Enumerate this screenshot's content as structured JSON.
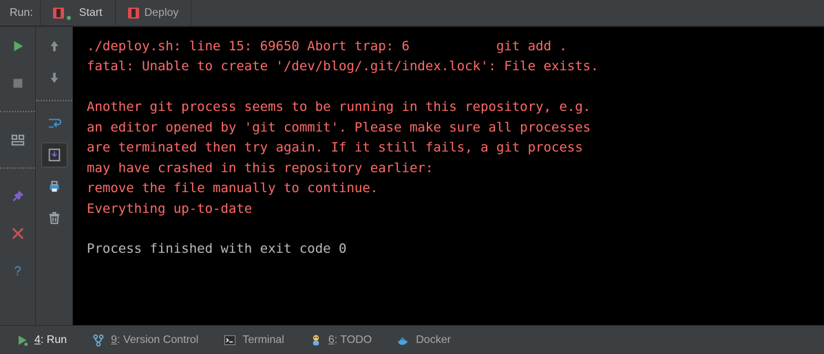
{
  "header": {
    "label": "Run:",
    "tabs": [
      {
        "label": "Start",
        "active": true
      },
      {
        "label": "Deploy",
        "active": false
      }
    ]
  },
  "gutter_a": {
    "items": [
      {
        "name": "run-play-icon",
        "kind": "play"
      },
      {
        "name": "run-stop-icon",
        "kind": "stop"
      },
      {
        "name": "break",
        "kind": "break"
      },
      {
        "name": "layout-icon",
        "kind": "layout"
      },
      {
        "name": "break",
        "kind": "break"
      },
      {
        "name": "pin-icon",
        "kind": "pin"
      },
      {
        "name": "close-panel-icon",
        "kind": "close"
      },
      {
        "name": "help-icon",
        "kind": "help"
      }
    ]
  },
  "gutter_b": {
    "items": [
      {
        "name": "scroll-up-icon",
        "kind": "arrow-up"
      },
      {
        "name": "scroll-down-icon",
        "kind": "arrow-down"
      },
      {
        "name": "break",
        "kind": "break"
      },
      {
        "name": "soft-wrap-icon",
        "kind": "wrap"
      },
      {
        "name": "scroll-to-end-icon",
        "kind": "scroll-end",
        "active": true
      },
      {
        "name": "print-icon",
        "kind": "print"
      },
      {
        "name": "clear-all-icon",
        "kind": "trash"
      }
    ]
  },
  "console": {
    "lines": [
      {
        "cls": "err",
        "text": "./deploy.sh: line 15: 69650 Abort trap: 6           git add ."
      },
      {
        "cls": "err",
        "text": "fatal: Unable to create '/dev/blog/.git/index.lock': File exists."
      },
      {
        "cls": "err",
        "text": ""
      },
      {
        "cls": "err",
        "text": "Another git process seems to be running in this repository, e.g."
      },
      {
        "cls": "err",
        "text": "an editor opened by 'git commit'. Please make sure all processes"
      },
      {
        "cls": "err",
        "text": "are terminated then try again. If it still fails, a git process"
      },
      {
        "cls": "err",
        "text": "may have crashed in this repository earlier:"
      },
      {
        "cls": "err",
        "text": "remove the file manually to continue."
      },
      {
        "cls": "err",
        "text": "Everything up-to-date"
      },
      {
        "cls": "ok",
        "text": ""
      },
      {
        "cls": "ok",
        "text": "Process finished with exit code 0"
      }
    ]
  },
  "footer": {
    "items": [
      {
        "name": "footer-run",
        "icon": "play",
        "pre": "",
        "ul": "4",
        "post": ": Run",
        "active": true
      },
      {
        "name": "footer-version-control",
        "icon": "branch",
        "pre": "",
        "ul": "9",
        "post": ": Version Control",
        "active": false
      },
      {
        "name": "footer-terminal",
        "icon": "terminal",
        "pre": "Terminal",
        "ul": "",
        "post": "",
        "active": false
      },
      {
        "name": "footer-todo",
        "icon": "todo",
        "pre": "",
        "ul": "6",
        "post": ": TODO",
        "active": false
      },
      {
        "name": "footer-docker",
        "icon": "docker",
        "pre": "Docker",
        "ul": "",
        "post": "",
        "active": false
      }
    ]
  }
}
